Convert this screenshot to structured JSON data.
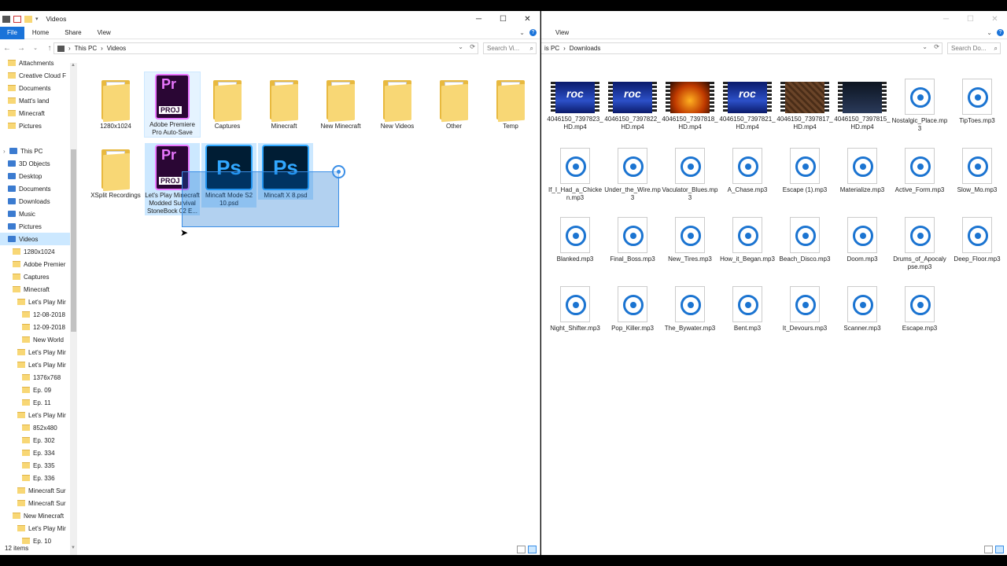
{
  "left": {
    "title": "Videos",
    "ribbon": {
      "file": "File",
      "home": "Home",
      "share": "Share",
      "view": "View"
    },
    "address": {
      "this_pc": "This PC",
      "sep": "›",
      "current": "Videos"
    },
    "search_placeholder": "Search Vi...",
    "nav": [
      {
        "label": "Attachments",
        "icon": "folder",
        "indent": 1
      },
      {
        "label": "Creative Cloud F",
        "icon": "folder",
        "indent": 1
      },
      {
        "label": "Documents",
        "icon": "folder",
        "indent": 1
      },
      {
        "label": "Matt's land",
        "icon": "folder",
        "indent": 1
      },
      {
        "label": "Minecraft",
        "icon": "folder",
        "indent": 1
      },
      {
        "label": "Pictures",
        "icon": "folder",
        "indent": 1
      },
      {
        "label": "",
        "icon": "none",
        "indent": 0
      },
      {
        "label": "This PC",
        "icon": "pc",
        "indent": 0
      },
      {
        "label": "3D Objects",
        "icon": "pc",
        "indent": 1
      },
      {
        "label": "Desktop",
        "icon": "pc",
        "indent": 1
      },
      {
        "label": "Documents",
        "icon": "pc",
        "indent": 1
      },
      {
        "label": "Downloads",
        "icon": "pc",
        "indent": 1
      },
      {
        "label": "Music",
        "icon": "pc",
        "indent": 1
      },
      {
        "label": "Pictures",
        "icon": "pc",
        "indent": 1
      },
      {
        "label": "Videos",
        "icon": "pc",
        "indent": 1,
        "selected": true
      },
      {
        "label": "1280x1024",
        "icon": "folder",
        "indent": 2
      },
      {
        "label": "Adobe Premier",
        "icon": "folder",
        "indent": 2
      },
      {
        "label": "Captures",
        "icon": "folder",
        "indent": 2
      },
      {
        "label": "Minecraft",
        "icon": "folder",
        "indent": 2
      },
      {
        "label": "Let's Play Mir",
        "icon": "folder",
        "indent": 3
      },
      {
        "label": "12-08-2018",
        "icon": "folder",
        "indent": 4
      },
      {
        "label": "12-09-2018",
        "icon": "folder",
        "indent": 4
      },
      {
        "label": "New World",
        "icon": "folder",
        "indent": 4
      },
      {
        "label": "Let's Play Mir",
        "icon": "folder",
        "indent": 3
      },
      {
        "label": "Let's Play Mir",
        "icon": "folder",
        "indent": 3
      },
      {
        "label": "1376x768",
        "icon": "folder",
        "indent": 4
      },
      {
        "label": "Ep. 09",
        "icon": "folder",
        "indent": 4
      },
      {
        "label": "Ep. 11",
        "icon": "folder",
        "indent": 4
      },
      {
        "label": "Let's Play Mir",
        "icon": "folder",
        "indent": 3
      },
      {
        "label": "852x480",
        "icon": "folder",
        "indent": 4
      },
      {
        "label": "Ep. 302",
        "icon": "folder",
        "indent": 4
      },
      {
        "label": "Ep. 334",
        "icon": "folder",
        "indent": 4
      },
      {
        "label": "Ep. 335",
        "icon": "folder",
        "indent": 4
      },
      {
        "label": "Ep. 336",
        "icon": "folder",
        "indent": 4
      },
      {
        "label": "Minecraft Sur",
        "icon": "folder",
        "indent": 3
      },
      {
        "label": "Minecraft Sur",
        "icon": "folder",
        "indent": 3
      },
      {
        "label": "New Minecraft",
        "icon": "folder",
        "indent": 2
      },
      {
        "label": "Let's Play Mir",
        "icon": "folder",
        "indent": 3
      },
      {
        "label": "Ep. 10",
        "icon": "folder",
        "indent": 4
      }
    ],
    "items": [
      {
        "label": "1280x1024",
        "type": "folder"
      },
      {
        "label": "Adobe Premiere Pro Auto-Save",
        "type": "prfolder",
        "state": "hover"
      },
      {
        "label": "Captures",
        "type": "folder"
      },
      {
        "label": "Minecraft",
        "type": "folder"
      },
      {
        "label": "New Minecraft",
        "type": "folder"
      },
      {
        "label": "New Videos",
        "type": "folder"
      },
      {
        "label": "Other",
        "type": "folder"
      },
      {
        "label": "Temp",
        "type": "folder"
      },
      {
        "label": "XSplit Recordings",
        "type": "folder"
      },
      {
        "label": "Let's Play Minecraft Modded Survival StoneBock 02 E...",
        "type": "prproj",
        "state": "selected"
      },
      {
        "label": "Mincaft Mode S2 10.psd",
        "type": "psd",
        "state": "selected"
      },
      {
        "label": "Mincaft X 8.psd",
        "type": "psd",
        "state": "selected"
      }
    ],
    "status": "12 items"
  },
  "right": {
    "ribbon": {
      "view": "View"
    },
    "address": {
      "this_pc": "is PC",
      "sep": "›",
      "current": "Downloads"
    },
    "search_placeholder": "Search Do...",
    "items": [
      {
        "label": "4046150_7397823_HD.mp4",
        "type": "video",
        "thumb": "blue"
      },
      {
        "label": "4046150_7397822_HD.mp4",
        "type": "video",
        "thumb": "blue"
      },
      {
        "label": "4046150_7397818_HD.mp4",
        "type": "video",
        "thumb": "fire"
      },
      {
        "label": "4046150_7397821_HD.mp4",
        "type": "video",
        "thumb": "blue"
      },
      {
        "label": "4046150_7397817_HD.mp4",
        "type": "video",
        "thumb": "dirt"
      },
      {
        "label": "4046150_7397815_HD.mp4",
        "type": "video",
        "thumb": "dark"
      },
      {
        "label": "Nostalgic_Place.mp3",
        "type": "mp3"
      },
      {
        "label": "TipToes.mp3",
        "type": "mp3"
      },
      {
        "label": "If_I_Had_a_Chicken.mp3",
        "type": "mp3"
      },
      {
        "label": "Under_the_Wire.mp3",
        "type": "mp3"
      },
      {
        "label": "Vaculator_Blues.mp3",
        "type": "mp3"
      },
      {
        "label": "A_Chase.mp3",
        "type": "mp3"
      },
      {
        "label": "Escape (1).mp3",
        "type": "mp3"
      },
      {
        "label": "Materialize.mp3",
        "type": "mp3"
      },
      {
        "label": "Active_Form.mp3",
        "type": "mp3"
      },
      {
        "label": "Slow_Mo.mp3",
        "type": "mp3"
      },
      {
        "label": "Blanked.mp3",
        "type": "mp3"
      },
      {
        "label": "Final_Boss.mp3",
        "type": "mp3"
      },
      {
        "label": "New_Tires.mp3",
        "type": "mp3"
      },
      {
        "label": "How_it_Began.mp3",
        "type": "mp3"
      },
      {
        "label": "Beach_Disco.mp3",
        "type": "mp3"
      },
      {
        "label": "Doom.mp3",
        "type": "mp3"
      },
      {
        "label": "Drums_of_Apocalypse.mp3",
        "type": "mp3"
      },
      {
        "label": "Deep_Floor.mp3",
        "type": "mp3"
      },
      {
        "label": "Night_Shifter.mp3",
        "type": "mp3"
      },
      {
        "label": "Pop_Killer.mp3",
        "type": "mp3"
      },
      {
        "label": "The_Bywater.mp3",
        "type": "mp3"
      },
      {
        "label": "Bent.mp3",
        "type": "mp3"
      },
      {
        "label": "It_Devours.mp3",
        "type": "mp3"
      },
      {
        "label": "Scanner.mp3",
        "type": "mp3"
      },
      {
        "label": "Escape.mp3",
        "type": "mp3"
      }
    ]
  },
  "vid_logo": "roc"
}
